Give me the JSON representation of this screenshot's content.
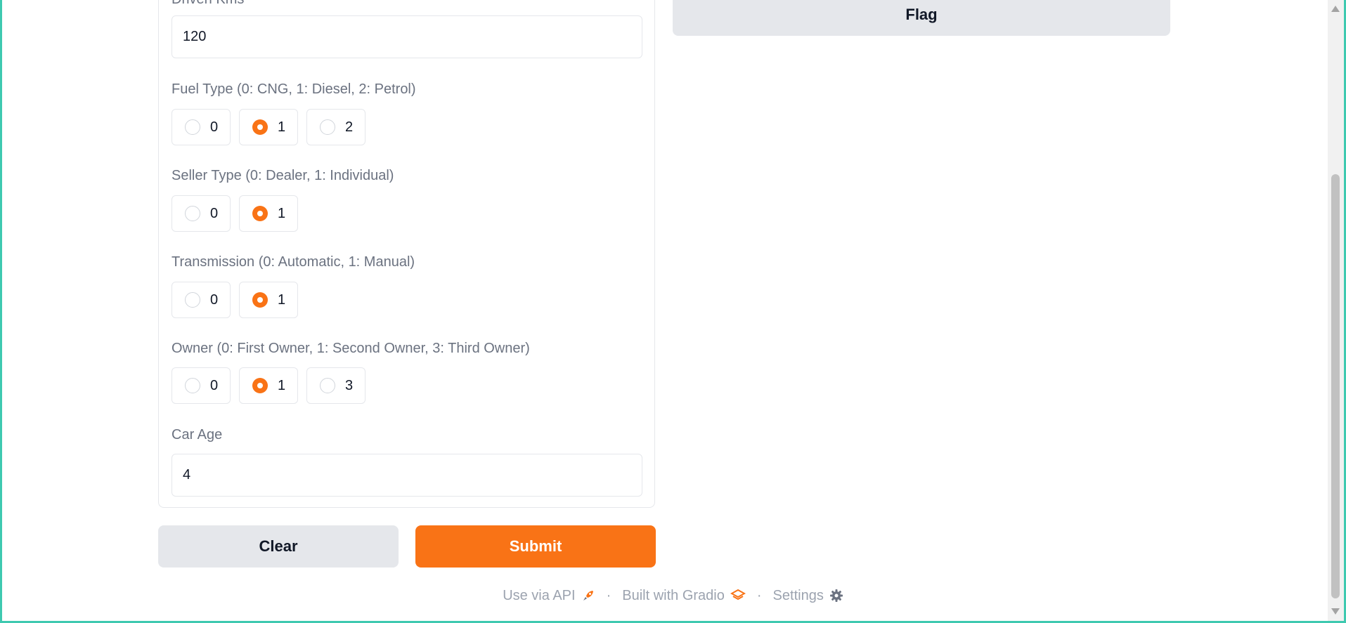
{
  "inputs": {
    "driven_kms": {
      "label": "Driven Kms",
      "value": "120"
    },
    "fuel_type": {
      "label": "Fuel Type (0: CNG, 1: Diesel, 2: Petrol)",
      "options": [
        "0",
        "1",
        "2"
      ],
      "selected": "1"
    },
    "seller_type": {
      "label": "Seller Type (0: Dealer, 1: Individual)",
      "options": [
        "0",
        "1"
      ],
      "selected": "1"
    },
    "transmission": {
      "label": "Transmission (0: Automatic, 1: Manual)",
      "options": [
        "0",
        "1"
      ],
      "selected": "1"
    },
    "owner": {
      "label": "Owner (0: First Owner, 1: Second Owner, 3: Third Owner)",
      "options": [
        "0",
        "1",
        "3"
      ],
      "selected": "1"
    },
    "car_age": {
      "label": "Car Age",
      "value": "4"
    }
  },
  "buttons": {
    "flag": "Flag",
    "clear": "Clear",
    "submit": "Submit"
  },
  "footer": {
    "api": "Use via API",
    "separator": "·",
    "built_with": "Built with Gradio",
    "settings": "Settings"
  },
  "colors": {
    "accent": "#f97316",
    "border": "#e5e7eb",
    "frame": "#3ec9b0"
  }
}
